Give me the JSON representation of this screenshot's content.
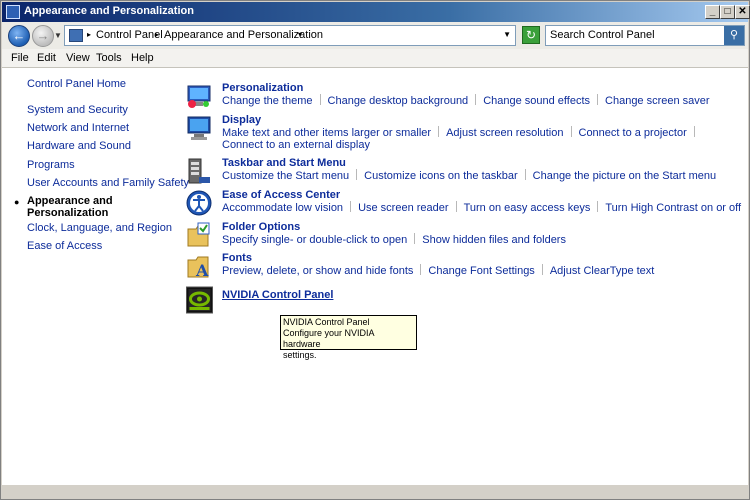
{
  "window": {
    "title": "Appearance and Personalization"
  },
  "address": {
    "crumb1": "Control Panel",
    "crumb2": "Appearance and Personalization"
  },
  "search": {
    "placeholder": "Search Control Panel"
  },
  "menu": [
    "File",
    "Edit",
    "View",
    "Tools",
    "Help"
  ],
  "leftnav": {
    "home": "Control Panel Home",
    "items": [
      "System and Security",
      "Network and Internet",
      "Hardware and Sound",
      "Programs",
      "User Accounts and Family Safety"
    ],
    "current_line1": "Appearance and",
    "current_line2": "Personalization",
    "after": [
      "Clock, Language, and Region",
      "Ease of Access"
    ]
  },
  "categories": {
    "personalization": {
      "title": "Personalization",
      "links": [
        "Change the theme",
        "Change desktop background",
        "Change sound effects",
        "Change screen saver"
      ]
    },
    "display": {
      "title": "Display",
      "links": [
        "Make text and other items larger or smaller",
        "Adjust screen resolution",
        "Connect to a projector",
        "Connect to an external display"
      ]
    },
    "taskbar": {
      "title": "Taskbar and Start Menu",
      "links": [
        "Customize the Start menu",
        "Customize icons on the taskbar",
        "Change the picture on the Start menu"
      ]
    },
    "ease": {
      "title": "Ease of Access Center",
      "links": [
        "Accommodate low vision",
        "Use screen reader",
        "Turn on easy access keys",
        "Turn High Contrast on or off"
      ]
    },
    "folder": {
      "title": "Folder Options",
      "links": [
        "Specify single- or double-click to open",
        "Show hidden files and folders"
      ]
    },
    "fonts": {
      "title": "Fonts",
      "links": [
        "Preview, delete, or show and hide fonts",
        "Change Font Settings",
        "Adjust ClearType text"
      ]
    },
    "nvidia": {
      "title": "NVIDIA Control Panel"
    }
  },
  "tooltip": {
    "line1": "NVIDIA Control Panel",
    "line2": "Configure your NVIDIA hardware",
    "line3": "settings."
  },
  "icons": [
    "window-icon",
    "back-arrow-icon",
    "forward-arrow-icon",
    "control-panel-icon",
    "refresh-icon",
    "search-icon",
    "personalization-icon",
    "display-icon",
    "taskbar-icon",
    "ease-of-access-icon",
    "folder-options-icon",
    "fonts-icon",
    "nvidia-icon"
  ]
}
